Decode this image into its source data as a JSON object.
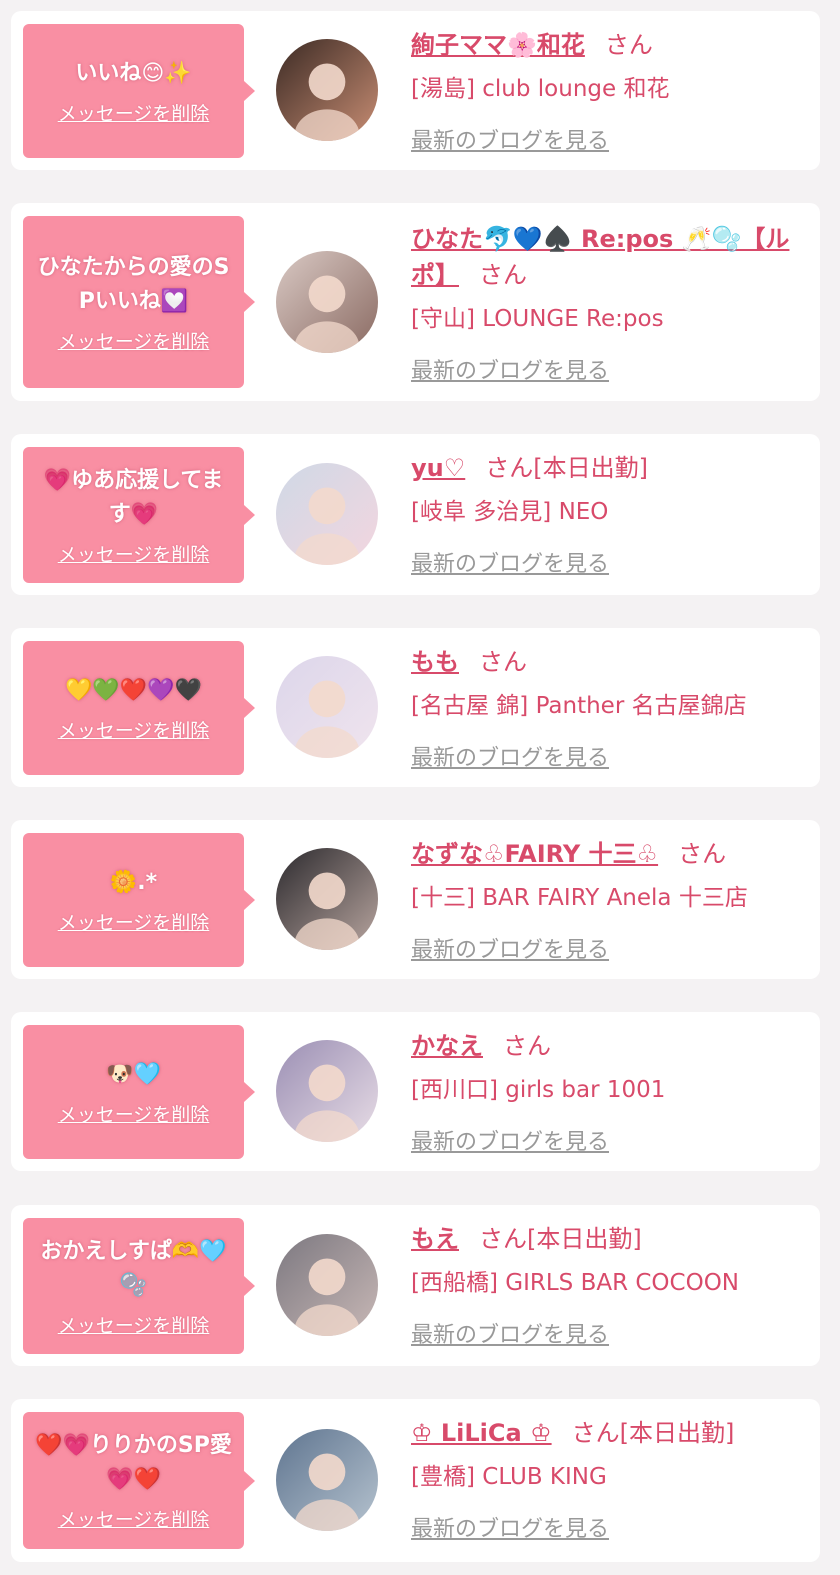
{
  "delete_label": "メッセージを削除",
  "blog_label": "最新のブログを見る",
  "san": "さん",
  "colors": {
    "accent": "#d84a6a",
    "bubble": "#f98fa3",
    "background": "#f4f2f3"
  },
  "items": [
    {
      "message": "いいね😊✨",
      "name": "絢子ママ🌸和花",
      "status": "",
      "shop": "[湯島] club lounge 和花",
      "avatar_icon": "avatar-photo"
    },
    {
      "message": "ひなたからの愛のSPいいね💟",
      "name": "ひなた🐬💙♠️ Re:pos 🥂🫧【ルポ】",
      "status": "",
      "shop": "[守山] LOUNGE Re:pos",
      "avatar_icon": "avatar-photo"
    },
    {
      "message": "💗ゆあ応援してます💗",
      "name": "yu♡",
      "status": "[本日出勤]",
      "shop": "[岐阜 多治見] NEO",
      "avatar_icon": "avatar-photo"
    },
    {
      "message": "💛💚❤️💜🖤",
      "name": "もも",
      "status": "",
      "shop": "[名古屋 錦] Panther 名古屋錦店",
      "avatar_icon": "avatar-photo"
    },
    {
      "message": "🌼.*",
      "name": "なずな♧FAIRY 十三♧",
      "status": "",
      "shop": "[十三] BAR FAIRY Anela 十三店",
      "avatar_icon": "avatar-photo"
    },
    {
      "message": "🐶🩵",
      "name": "かなえ",
      "status": "",
      "shop": "[西川口] girls bar 1001",
      "avatar_icon": "avatar-photo"
    },
    {
      "message": "おかえしすぱ🫶🩵🫧",
      "name": "もえ",
      "status": "[本日出勤]",
      "shop": "[西船橋] GIRLS BAR COCOON",
      "avatar_icon": "avatar-photo"
    },
    {
      "message": "❤️💗りりかのSP愛💗❤️",
      "name": "♔ LiLiCa ♔",
      "status": "[本日出勤]",
      "shop": "[豊橋] CLUB KING",
      "avatar_icon": "avatar-photo"
    }
  ]
}
